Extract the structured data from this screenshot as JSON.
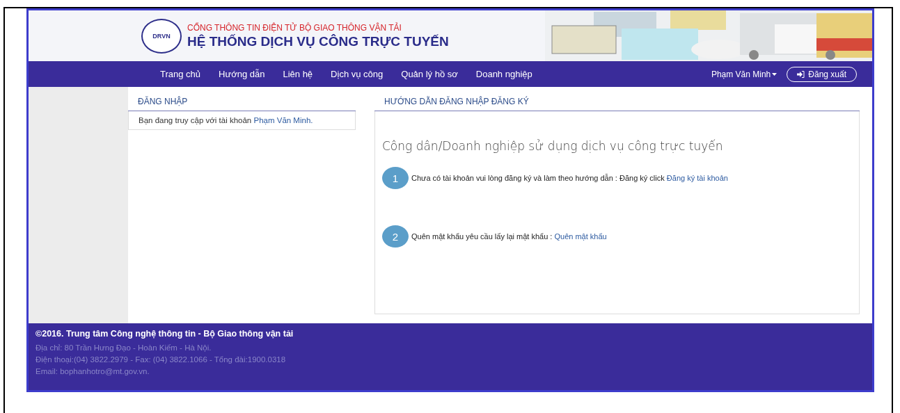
{
  "header": {
    "subtitle": "CỔNG THÔNG TIN ĐIỆN TỬ BỘ GIAO THÔNG VẬN TẢI",
    "title": "HỆ THỐNG DỊCH VỤ CÔNG TRỰC TUYẾN",
    "logo_text": "DRVN"
  },
  "nav": {
    "items": [
      {
        "label": "Trang chủ"
      },
      {
        "label": "Hướng dẫn"
      },
      {
        "label": "Liên hệ"
      },
      {
        "label": "Dịch vụ công"
      },
      {
        "label": "Quản lý hồ sơ"
      },
      {
        "label": "Doanh nghiệp"
      }
    ],
    "user": "Phạm Văn Minh",
    "logout": "Đăng xuất"
  },
  "login_panel": {
    "title": "ĐĂNG NHẬP",
    "text": "Bạn đang truy cập với tài khoản",
    "user_link": "Phạm Văn Minh."
  },
  "guide_panel": {
    "title": "HƯỚNG DẪN ĐĂNG NHẬP ĐĂNG KÝ",
    "heading": "Công dân/Doanh nghiệp sử dụng dịch vụ công trực tuyến",
    "steps": [
      {
        "number": "1",
        "text": "Chưa có tài khoản vui lòng đăng ký và làm theo hướng dẫn : Đăng ký click",
        "link": "Đăng ký tài khoản"
      },
      {
        "number": "2",
        "text": "Quên mật khẩu  yêu cầu lấy lại mật khẩu :",
        "link": "Quên mật khẩu"
      }
    ]
  },
  "footer": {
    "copyright": "©2016. Trung tâm Công nghệ thông tin - Bộ Giao thông vận tải",
    "lines": [
      "Địa chỉ: 80 Trần Hưng Đạo - Hoàn Kiếm - Hà Nội.",
      "Điện thoại:(04) 3822.2979 - Fax: (04) 3822.1066 - Tổng đài:1900.0318",
      "Email: bophanhotro@mt.gov.vn."
    ]
  }
}
